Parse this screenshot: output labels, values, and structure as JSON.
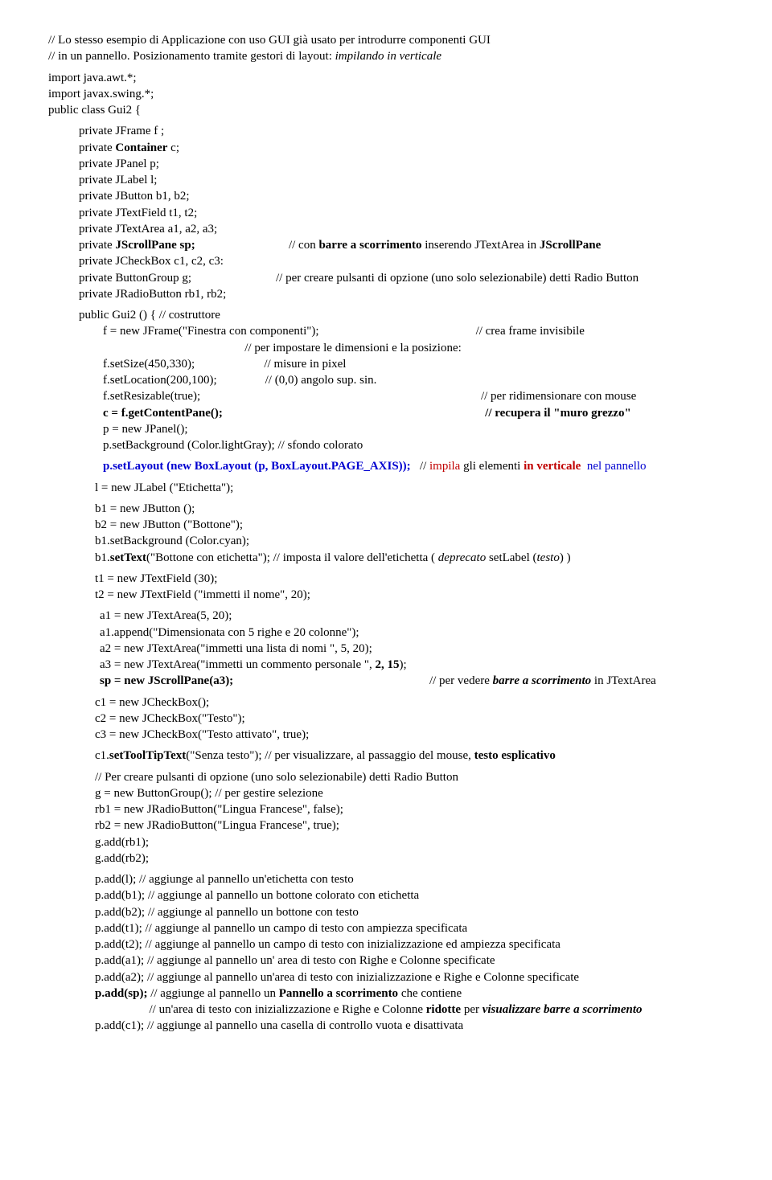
{
  "header": {
    "c1": "// Lo stesso esempio di Applicazione con uso GUI già usato per introdurre componenti GUI",
    "c2a": "// in un pannello. Posizionamento tramite gestori di layout: ",
    "c2b": "impilando in verticale"
  },
  "imports": {
    "l1": "import java.awt.*;",
    "l2": "import javax.swing.*;",
    "l3": "public class Gui2 {"
  },
  "decl": {
    "l1": "private  JFrame f ;",
    "l2a": "private ",
    "l2b": "Container",
    "l2c": "  c;",
    "l3": "private JPanel p;",
    "l4": "private JLabel  l;",
    "l5": "private  JButton b1, b2;",
    "l6": "private  JTextField t1, t2;",
    "l7": "private  JTextArea a1, a2, a3;",
    "l8a": "private ",
    "l8b": "JScrollPane sp;",
    "l8c": "                               // con ",
    "l8d": "barre a scorrimento",
    "l8e": " inserendo JTextArea in ",
    "l8f": "JScrollPane",
    "l9": "private  JCheckBox c1, c2, c3:",
    "l10a": "private ButtonGroup g;                            ",
    "l10b": "// per creare pulsanti di opzione (uno solo selezionabile) detti Radio Button",
    "l11": "private  JRadioButton rb1, rb2;"
  },
  "ctor": {
    "l1": "public Gui2 ()     {       // costruttore",
    "l2a": "f = new JFrame(\"Finestra con componenti\");                                                    ",
    "l2b": "// crea frame invisibile",
    "l3": "                                               // per impostare le dimensioni e la posizione:",
    "l4": "f.setSize(450,330);                       // misure in pixel",
    "l5": "f.setLocation(200,100);                // (0,0) angolo sup. sin.",
    "l6a": "f.setResizable(true);                                                                                             ",
    "l6b": "// per ridimensionare con mouse",
    "l7a": "c = f.getContentPane();",
    "l7b": "                                                                                       // recupera il \"muro grezzo\"",
    "l8": "p = new JPanel();",
    "l9": "p.setBackground (Color.lightGray);    // sfondo colorato"
  },
  "layout": {
    "l1a": "p.setLayout (new BoxLayout (p, BoxLayout.PAGE_AXIS));",
    "l1b": "   // ",
    "l1c": "impila",
    "l1d": " gli elementi ",
    "l1e": "in verticale",
    "l1f": "  nel pannello"
  },
  "body": {
    "l1": "l = new JLabel (\"Etichetta\");",
    "l2": "b1 = new JButton ();",
    "l3": "b2 = new JButton (\"Bottone\");",
    "l4": "b1.setBackground (Color.cyan);",
    "l5a": "b1.",
    "l5b": "setText",
    "l5c": "(\"Bottone con etichetta\"); // imposta il valore dell'etichetta ( ",
    "l5d": "deprecato ",
    "l5e": "setLabel (",
    "l5f": "testo",
    "l5g": ") )",
    "l6": "t1 = new JTextField (30);",
    "l7": "t2 = new JTextField (\"immetti il nome\", 20);",
    "l8": "a1 = new JTextArea(5, 20);",
    "l9": "a1.append(\"Dimensionata con 5 righe e 20 colonne\");",
    "l10": "a2 = new JTextArea(\"immetti una lista di nomi \", 5, 20);",
    "l11a": "a3 = new JTextArea(\"immetti un commento personale \", ",
    "l11b": "2, 15",
    "l11c": ");",
    "l12a": "sp = new JScrollPane(a3);",
    "l12b": "                                                                 // per vedere ",
    "l12c": "barre a scorrimento",
    "l12d": " in JTextArea",
    "l13": "c1 = new JCheckBox();",
    "l14": "c2 = new JCheckBox(\"Testo\");",
    "l15": "c3 = new JCheckBox(\"Testo attivato\", true);",
    "l16a": "c1.",
    "l16b": "setToolTipText",
    "l16c": "(\"Senza testo\");  // per visualizzare, al passaggio del mouse, ",
    "l16d": "testo esplicativo",
    "l17": "// Per creare pulsanti di opzione (uno solo selezionabile) detti Radio Button",
    "l18": "g = new ButtonGroup();  // per gestire selezione",
    "l19": "rb1 = new JRadioButton(\"Lingua Francese\", false);",
    "l20": "rb2 = new JRadioButton(\"Lingua Francese\", true);",
    "l21": "g.add(rb1);",
    "l22": "g.add(rb2);",
    "p1": "p.add(l);    // aggiunge al pannello un'etichetta con testo",
    "p2": "p.add(b1);  // aggiunge al pannello un bottone colorato con etichetta",
    "p3": "p.add(b2);  // aggiunge al pannello un bottone con testo",
    "p4": "p.add(t1);  // aggiunge al pannello un campo di testo con ampiezza specificata",
    "p5": "p.add(t2);  // aggiunge al pannello un campo di testo con inizializzazione  ed ampiezza specificata",
    "p6": "p.add(a1);  // aggiunge al pannello un' area di testo con Righe e Colonne specificate",
    "p7": "p.add(a2);  // aggiunge al pannello un'area di testo con inizializzazione  e Righe e Colonne specificate",
    "p8a": "p.add(sp);",
    "p8b": "  // aggiunge al pannello un ",
    "p8c": "Pannello a scorrimento",
    "p8d": " che contiene",
    "p9a": "                  // un'area di testo con inizializzazione e Righe e Colonne ",
    "p9b": "ridotte",
    "p9c": " per ",
    "p9d": "visualizzare barre a scorrimento",
    "p10": " p.add(c1);  // aggiunge al pannello una casella di controllo vuota e disattivata"
  }
}
